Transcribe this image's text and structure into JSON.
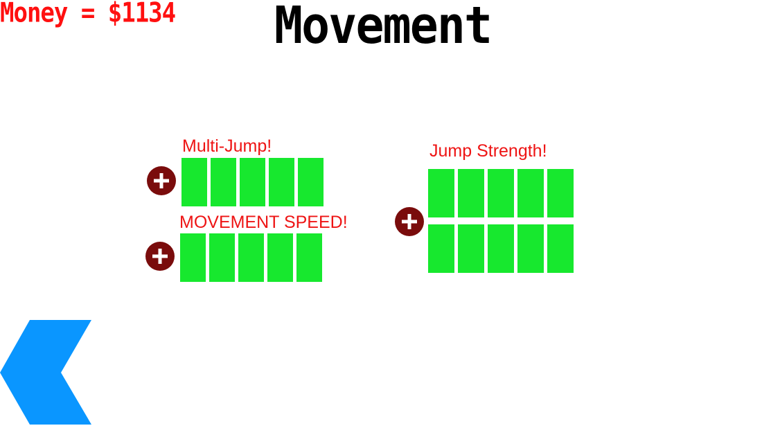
{
  "hud": {
    "money_text": "Money = $1134"
  },
  "page": {
    "title": "Movement"
  },
  "upgrades": [
    {
      "id": "multi_jump",
      "label": "Multi-Jump!",
      "level": 5,
      "max_level": 5
    },
    {
      "id": "movement_speed",
      "label": "MOVEMENT SPEED!",
      "level": 5,
      "max_level": 5
    },
    {
      "id": "jump_strength",
      "label": "Jump Strength!",
      "level": 10,
      "max_level": 10
    }
  ],
  "icons": {
    "upgrade_button": "plus-icon",
    "back_button": "chevron-left-icon"
  },
  "colors": {
    "money_text": "#ff1010",
    "label_text": "#ee1414",
    "bar_fill": "#17e82e",
    "plus_button": "#7a0c0c",
    "back_arrow": "#0a96ff"
  }
}
